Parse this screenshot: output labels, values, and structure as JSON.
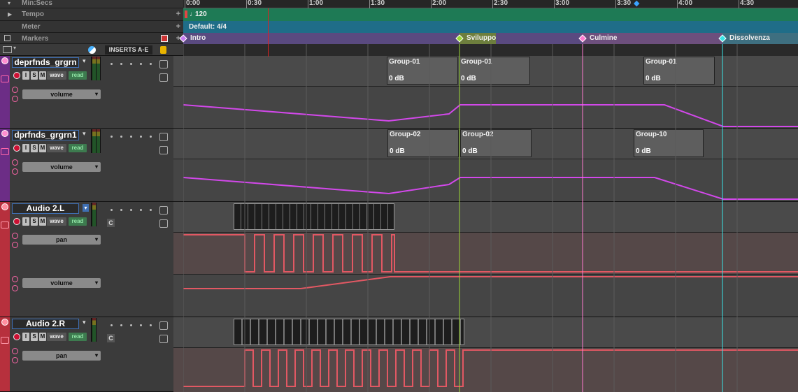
{
  "timeline": {
    "min_secs_label": "Min:Secs",
    "ticks": [
      "0:00",
      "0:30",
      "1:00",
      "1:30",
      "2:00",
      "2:30",
      "3:00",
      "3:30",
      "4:00",
      "4:30"
    ],
    "tempo_label": "Tempo",
    "tempo_value": "120",
    "meter_label": "Meter",
    "meter_value": "Default: 4/4",
    "markers_label": "Markers",
    "markers": [
      {
        "name": "Intro",
        "color": "#c77cf0"
      },
      {
        "name": "Sviluppo",
        "color": "#9bd635"
      },
      {
        "name": "Culmine",
        "color": "#ff7ad0"
      },
      {
        "name": "Dissolvenza",
        "color": "#39e4e6"
      }
    ]
  },
  "header": {
    "inserts_label": "INSERTS A-E"
  },
  "colors": {
    "purple_track": "#6c2d86",
    "red_track": "#b7303d",
    "automation_purple": "#d248ea",
    "automation_red": "#e25863"
  },
  "tracks": [
    {
      "name": "deprfnds_grgrn",
      "buttons": [
        "I",
        "S",
        "M"
      ],
      "view": "wave",
      "mode": "read",
      "automation": [
        "volume"
      ],
      "clips": [
        {
          "name": "Group-01",
          "gain": "0 dB"
        },
        {
          "name": "Group-01",
          "gain": "0 dB"
        },
        {
          "name": "Group-01",
          "gain": "0 dB"
        }
      ]
    },
    {
      "name": "dprfnds_grgrn1",
      "buttons": [
        "I",
        "S",
        "M"
      ],
      "view": "wave",
      "mode": "read",
      "automation": [
        "volume"
      ],
      "clips": [
        {
          "name": "Group-02",
          "gain": "0 dB"
        },
        {
          "name": "Group-02",
          "gain": "0 dB"
        },
        {
          "name": "Group-10",
          "gain": "0 dB"
        }
      ]
    },
    {
      "name": "Audio 2.L",
      "buttons": [
        "I",
        "S",
        "M"
      ],
      "view": "wave",
      "mode": "read",
      "slot_letter": "C",
      "automation": [
        "pan",
        "volume"
      ],
      "pan_labels": [
        "L",
        "R"
      ]
    },
    {
      "name": "Audio 2.R",
      "buttons": [
        "I",
        "S",
        "M"
      ],
      "view": "wave",
      "mode": "read",
      "slot_letter": "C",
      "automation": [
        "pan"
      ],
      "pan_labels": [
        "L",
        "R"
      ]
    }
  ]
}
